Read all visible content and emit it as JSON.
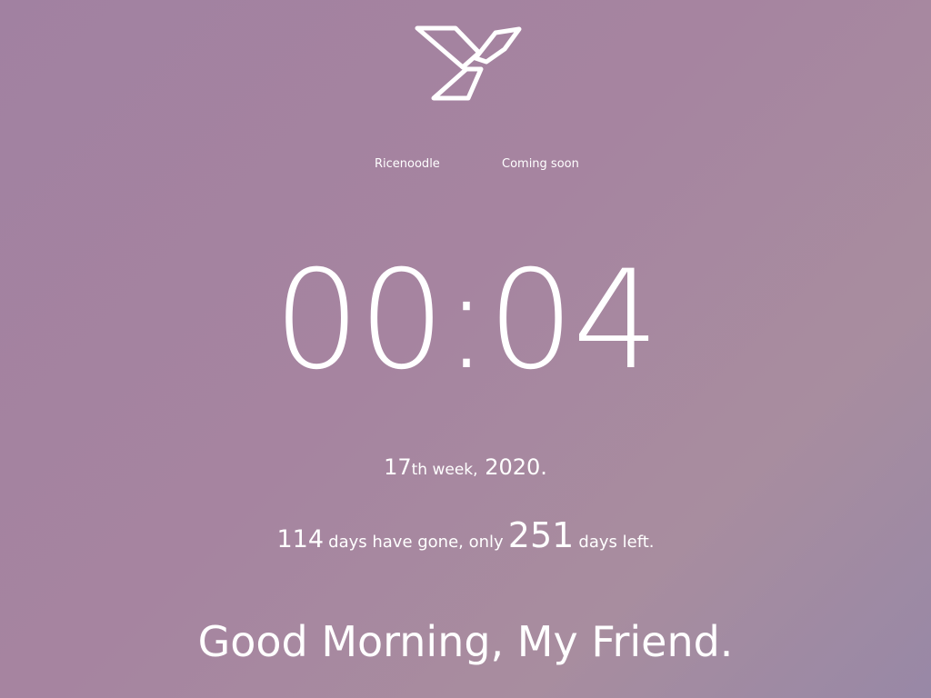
{
  "logo": {
    "icon": "bird-y-logo"
  },
  "nav": {
    "items": [
      {
        "label": "Ricenoodle"
      },
      {
        "label": "Coming soon"
      }
    ]
  },
  "clock": {
    "time": "00:04"
  },
  "week": {
    "number": "17",
    "suffix": "th week,",
    "year": "2020."
  },
  "days": {
    "gone": "114",
    "gone_text": "days have gone, only",
    "left": "251",
    "left_text": "days left."
  },
  "greeting": {
    "text": "Good Morning, My Friend."
  },
  "colors": {
    "background_start": "#a181a1",
    "background_end": "#9888a6",
    "text": "#ffffff"
  }
}
